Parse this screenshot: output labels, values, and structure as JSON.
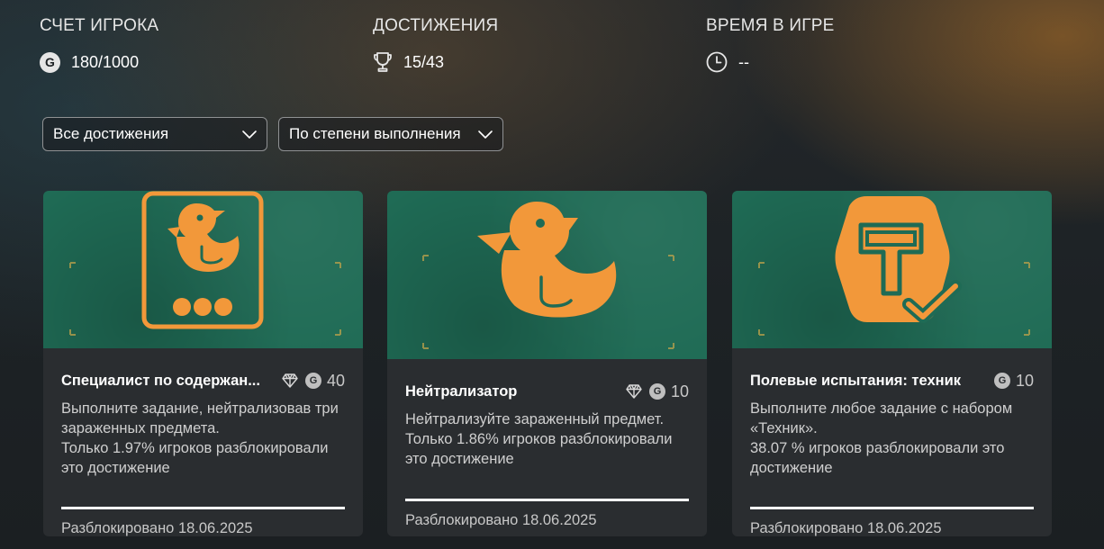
{
  "stats": [
    {
      "label": "СЧЕТ ИГРОКА",
      "value": "180/1000",
      "icon": "gamerscore-icon"
    },
    {
      "label": "ДОСТИЖЕНИЯ",
      "value": "15/43",
      "icon": "trophy-icon"
    },
    {
      "label": "ВРЕМЯ В ИГРЕ",
      "value": "--",
      "icon": "clock-icon"
    }
  ],
  "filters": {
    "type": "Все достижения",
    "sort": "По степени выполнения"
  },
  "gamerscore_glyph": "G",
  "colors": {
    "card_art_bg": "#1f6b55",
    "card_art_accent": "#f2983a",
    "card_bg": "#2a2d30",
    "progress_bar": "#ffffff"
  },
  "achievements": [
    {
      "title": "Специалист по содержан...",
      "gem": true,
      "points": "40",
      "description": "Выполните задание, нейтрализовав три зараженных предмета.",
      "rarity": "Только 1.97% игроков разблокировали это достижение",
      "progress": 1.0,
      "unlocked": "Разблокировано 18.06.2025",
      "icon": "duck-with-dots-icon"
    },
    {
      "title": "Нейтрализатор",
      "gem": true,
      "points": "10",
      "description": "Нейтрализуйте зараженный предмет.",
      "rarity": "Только 1.86% игроков разблокировали это достижение",
      "progress": 1.0,
      "unlocked": "Разблокировано 18.06.2025",
      "icon": "duck-icon"
    },
    {
      "title": "Полевые испытания: техник",
      "gem": false,
      "points": "10",
      "description": "Выполните любое задание с набором «Техник».",
      "rarity": "38.07 % игроков разблокировали это достижение",
      "progress": 1.0,
      "unlocked": "Разблокировано 18.06.2025",
      "icon": "technician-badge-icon"
    }
  ]
}
